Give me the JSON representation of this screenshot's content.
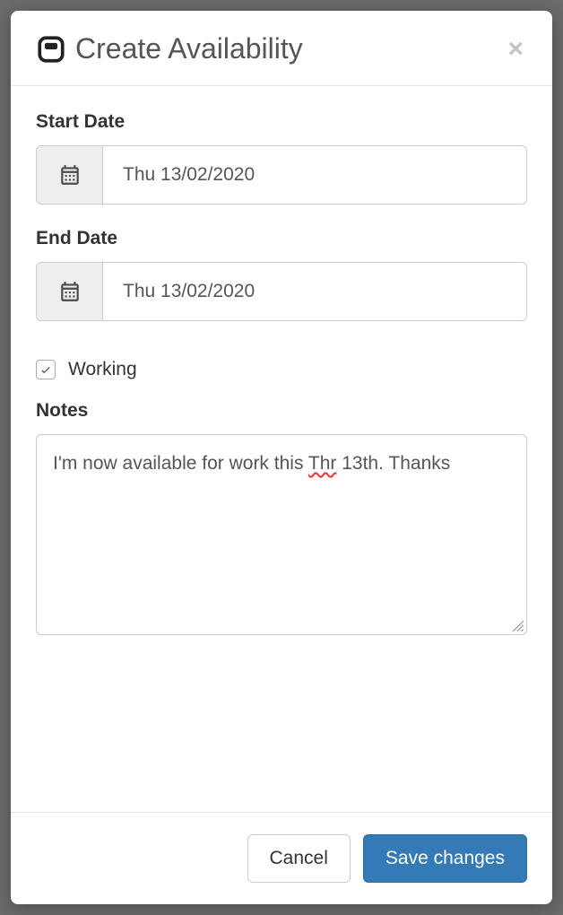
{
  "header": {
    "title": "Create Availability"
  },
  "form": {
    "start_date": {
      "label": "Start Date",
      "value": "Thu 13/02/2020"
    },
    "end_date": {
      "label": "End Date",
      "value": "Thu 13/02/2020"
    },
    "working": {
      "label": "Working",
      "checked": true
    },
    "notes": {
      "label": "Notes",
      "value_pre": "I'm now available for work this ",
      "value_err": "Thr",
      "value_post": " 13th. Thanks"
    }
  },
  "footer": {
    "cancel_label": "Cancel",
    "save_label": "Save changes"
  }
}
